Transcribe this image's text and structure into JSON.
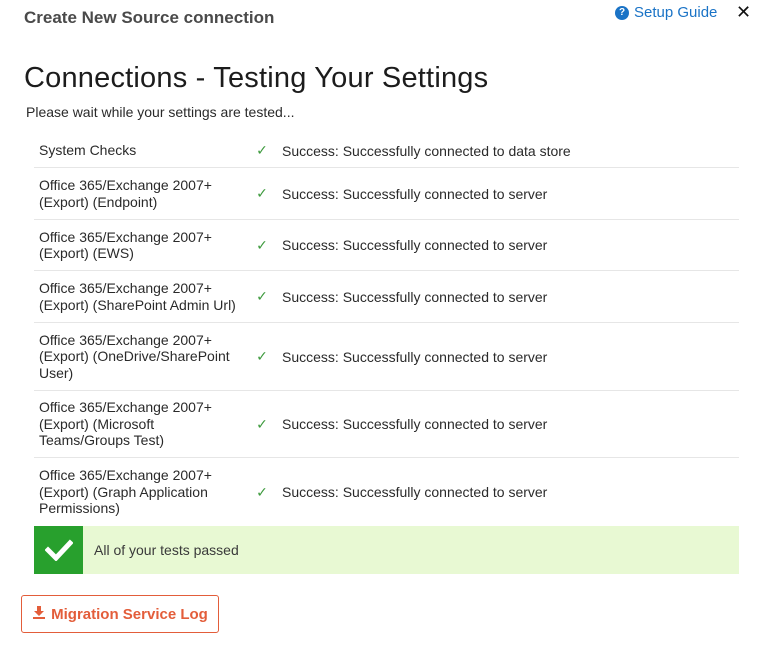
{
  "header": {
    "title": "Create New Source connection",
    "setup_guide": "Setup Guide",
    "close_symbol": "✕"
  },
  "main": {
    "title": "Connections - Testing Your Settings",
    "subtitle": "Please wait while your settings are tested..."
  },
  "results": [
    {
      "name": "System Checks",
      "status": "✓",
      "message": "Success: Successfully connected to data store"
    },
    {
      "name": "Office 365/Exchange 2007+ (Export) (Endpoint)",
      "status": "✓",
      "message": "Success: Successfully connected to server"
    },
    {
      "name": "Office 365/Exchange 2007+ (Export) (EWS)",
      "status": "✓",
      "message": "Success: Successfully connected to server"
    },
    {
      "name": "Office 365/Exchange 2007+ (Export) (SharePoint Admin Url)",
      "status": "✓",
      "message": "Success: Successfully connected to server"
    },
    {
      "name": "Office 365/Exchange 2007+ (Export) (OneDrive/SharePoint User)",
      "status": "✓",
      "message": "Success: Successfully connected to server"
    },
    {
      "name": "Office 365/Exchange 2007+ (Export) (Microsoft Teams/Groups Test)",
      "status": "✓",
      "message": "Success: Successfully connected to server"
    },
    {
      "name": "Office 365/Exchange 2007+ (Export) (Graph Application Permissions)",
      "status": "✓",
      "message": "Success: Successfully connected to server"
    }
  ],
  "banner": {
    "text": "All of your tests passed",
    "icon": "check-icon"
  },
  "log_button": {
    "label": "Migration Service Log",
    "icon": "download-icon"
  },
  "colors": {
    "accent_blue": "#1a73c6",
    "success_green": "#28a02d",
    "banner_bg": "#e8f9d3",
    "log_orange": "#e35d3a"
  }
}
